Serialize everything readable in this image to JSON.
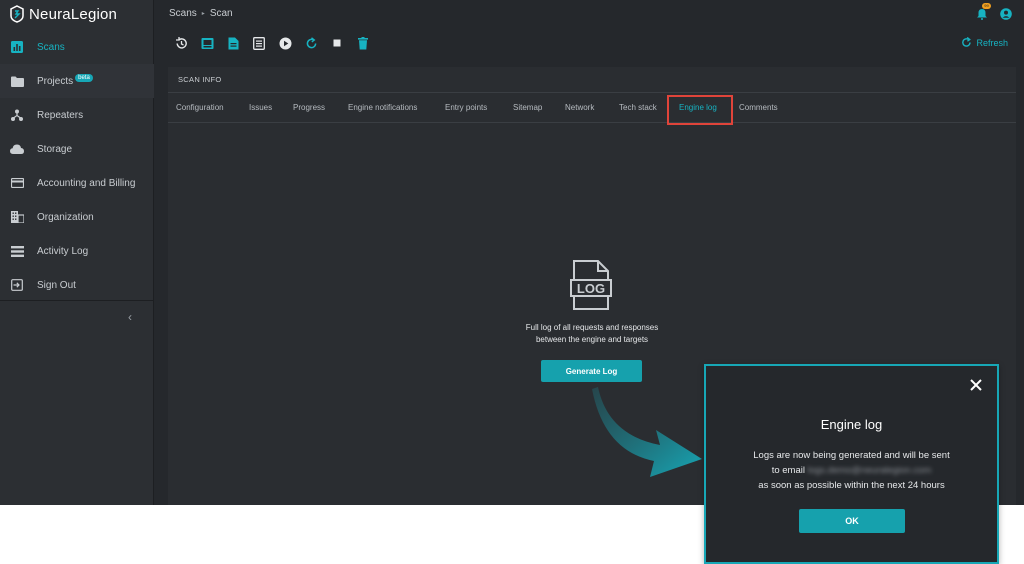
{
  "app": {
    "brand": "NeuraLegion"
  },
  "sidebar": {
    "items": [
      {
        "label": "Scans",
        "icon": "chart-icon",
        "active": true
      },
      {
        "label": "Projects",
        "icon": "folder-icon",
        "badge": "beta"
      },
      {
        "label": "Repeaters",
        "icon": "network-icon"
      },
      {
        "label": "Storage",
        "icon": "cloud-icon"
      },
      {
        "label": "Accounting and Billing",
        "icon": "credit-card-icon"
      },
      {
        "label": "Organization",
        "icon": "building-icon"
      },
      {
        "label": "Activity Log",
        "icon": "list-icon"
      },
      {
        "label": "Sign Out",
        "icon": "sign-out-icon"
      }
    ],
    "collapse": "‹"
  },
  "header": {
    "breadcrumb": [
      "Scans",
      "Scan"
    ],
    "breadcrumb_sep": "▸",
    "notification_badge": "99",
    "refresh_label": "Refresh"
  },
  "toolbar": {
    "icons": [
      "history-icon",
      "image-icon",
      "document-icon",
      "report-icon",
      "play-icon",
      "restart-icon",
      "stop-icon",
      "delete-icon"
    ]
  },
  "scan_info": {
    "heading": "SCAN INFO",
    "tabs": [
      {
        "label": "Configuration"
      },
      {
        "label": "Issues"
      },
      {
        "label": "Progress"
      },
      {
        "label": "Engine notifications"
      },
      {
        "label": "Entry points"
      },
      {
        "label": "Sitemap"
      },
      {
        "label": "Network"
      },
      {
        "label": "Tech stack"
      },
      {
        "label": "Engine log",
        "active": true
      },
      {
        "label": "Comments"
      }
    ],
    "empty_state": {
      "icon_text": "LOG",
      "line1": "Full log of all requests and responses",
      "line2": "between the engine and targets",
      "button": "Generate Log"
    }
  },
  "modal": {
    "title": "Engine log",
    "line1": "Logs are now being generated and will be sent",
    "line2_prefix": "to email",
    "email": "logs.demo@neuralegion.com",
    "line3": "as soon as possible within the next 24 hours",
    "ok": "OK"
  },
  "colors": {
    "accent": "#17b3c2",
    "background": "#25282c",
    "highlight": "#e0443a"
  }
}
